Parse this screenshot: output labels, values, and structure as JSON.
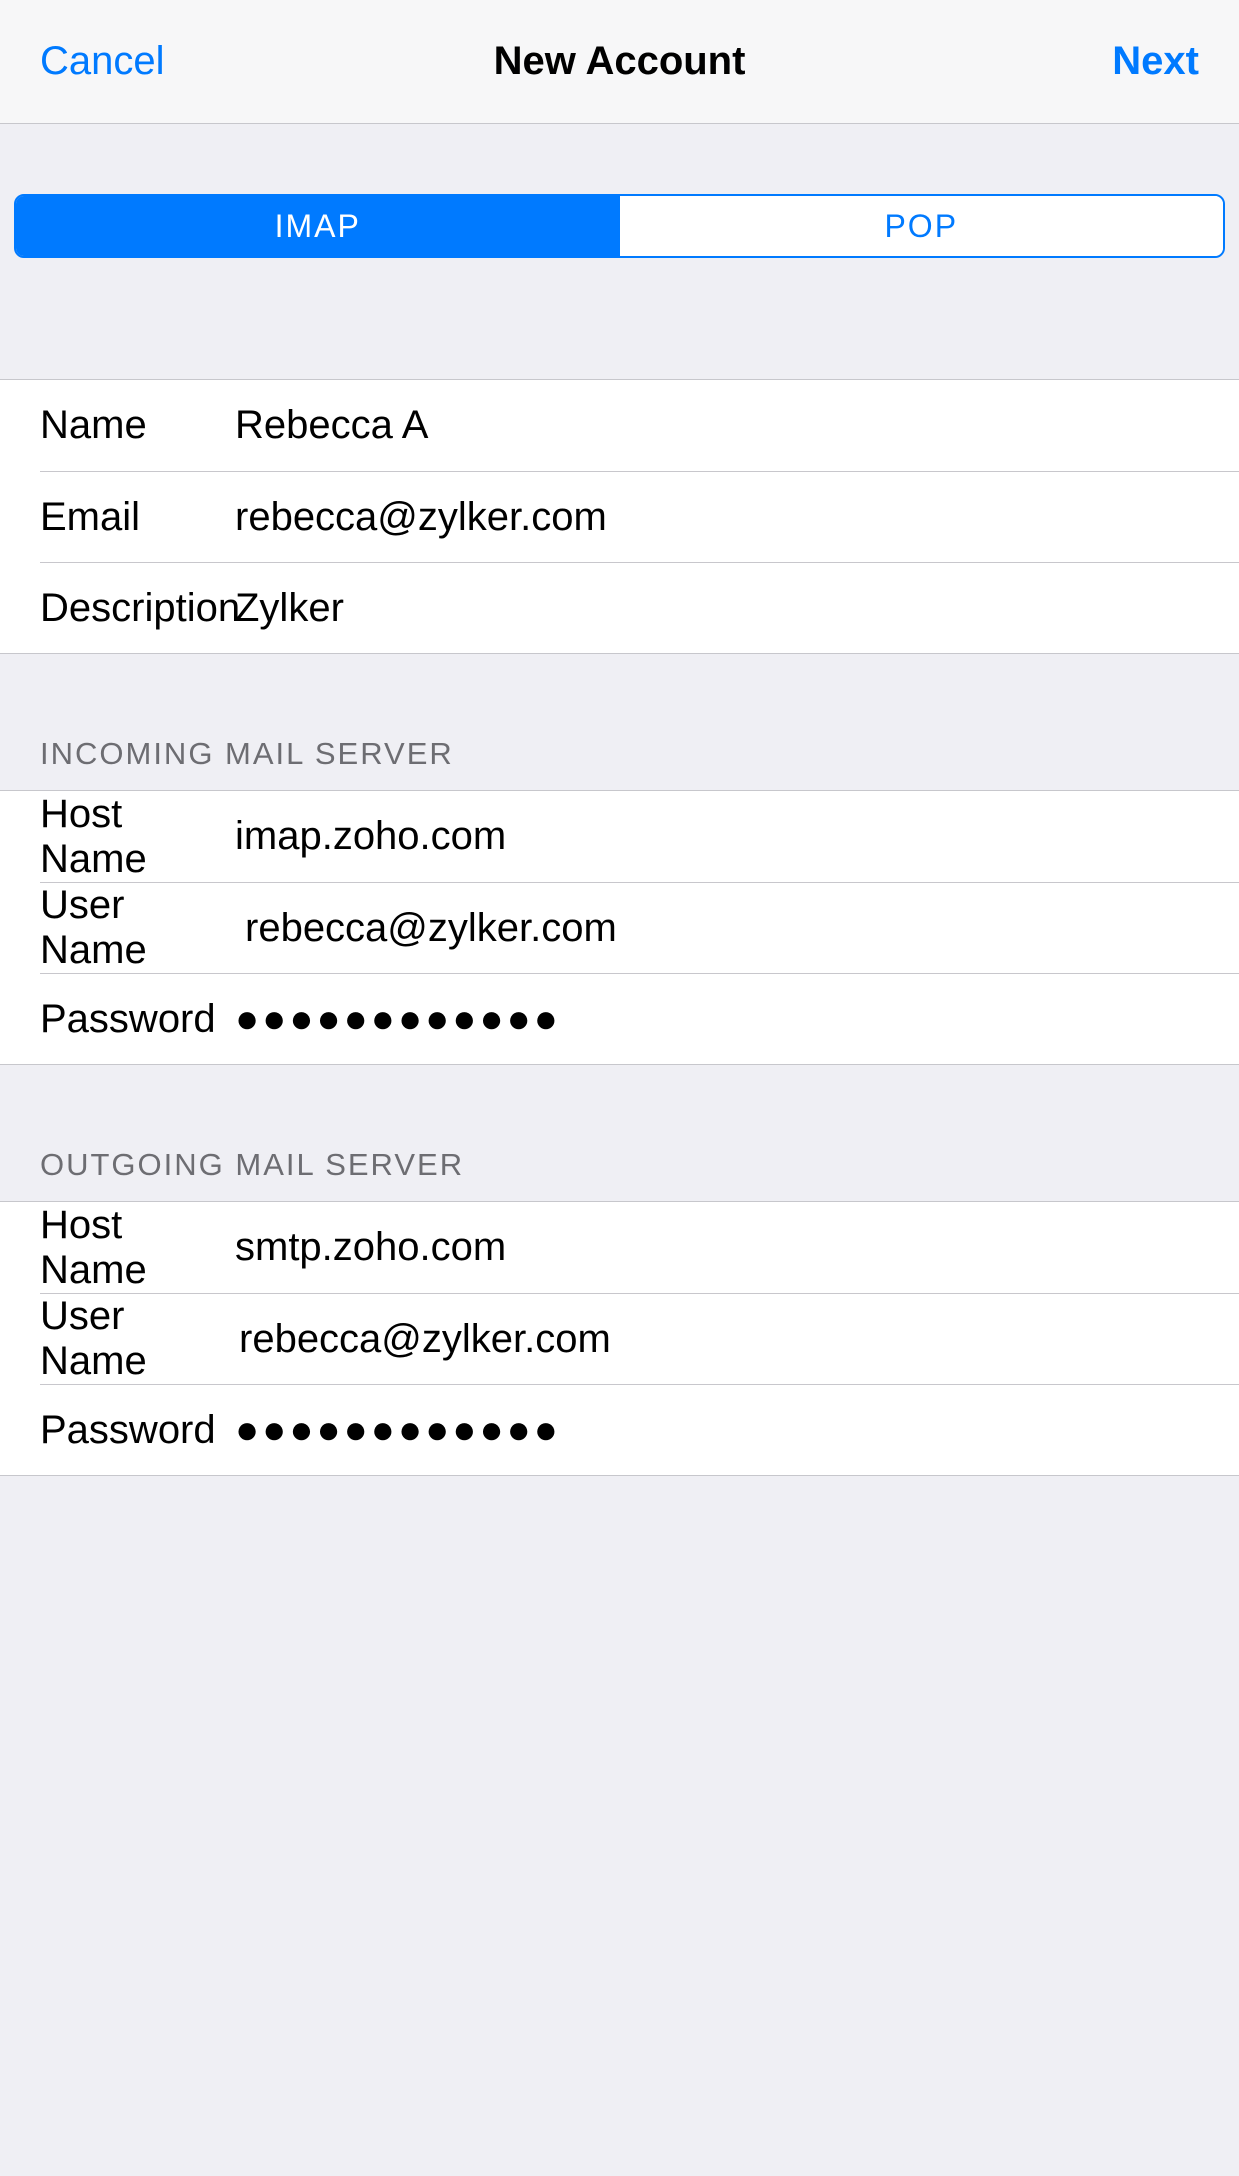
{
  "navbar": {
    "cancel_label": "Cancel",
    "title": "New Account",
    "next_label": "Next"
  },
  "protocol": {
    "imap_label": "IMAP",
    "pop_label": "POP",
    "selected": "IMAP"
  },
  "account": {
    "name_label": "Name",
    "name_value": "Rebecca A",
    "email_label": "Email",
    "email_value": "rebecca@zylker.com",
    "description_label": "Description",
    "description_value": "Zylker"
  },
  "incoming": {
    "header": "INCOMING MAIL SERVER",
    "host_label": "Host Name",
    "host_value": "imap.zoho.com",
    "user_label": "User Name",
    "user_value": "rebecca@zylker.com",
    "password_label": "Password",
    "password_mask": "●●●●●●●●●●●●"
  },
  "outgoing": {
    "header": "OUTGOING MAIL SERVER",
    "host_label": "Host Name",
    "host_value": "smtp.zoho.com",
    "user_label": "User Name",
    "user_value": "rebecca@zylker.com",
    "password_label": "Password",
    "password_mask": "●●●●●●●●●●●●"
  }
}
